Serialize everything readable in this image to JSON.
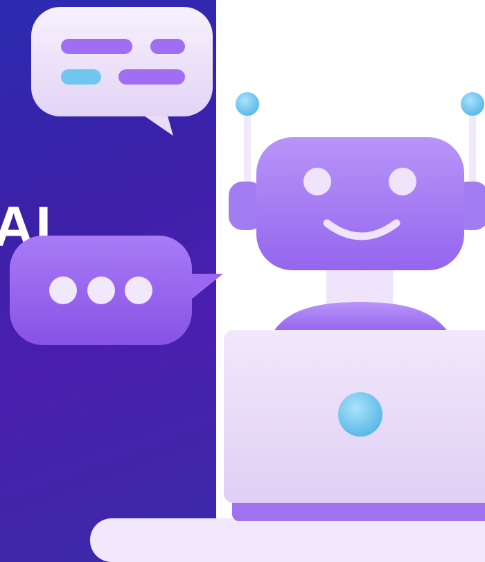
{
  "headline": {
    "text": "AI"
  },
  "illustration": {
    "subject": "robot-with-laptop",
    "icons": [
      "chat-bubble-icon",
      "typing-bubble-icon",
      "robot-icon",
      "laptop-icon"
    ]
  },
  "colors": {
    "panel_gradient_start": "#2c2bb0",
    "panel_gradient_end": "#4a1fae",
    "robot_purple": "#9b6cf0",
    "bubble_white": "#f1e8fb",
    "accent_cyan": "#6fc6ee"
  }
}
